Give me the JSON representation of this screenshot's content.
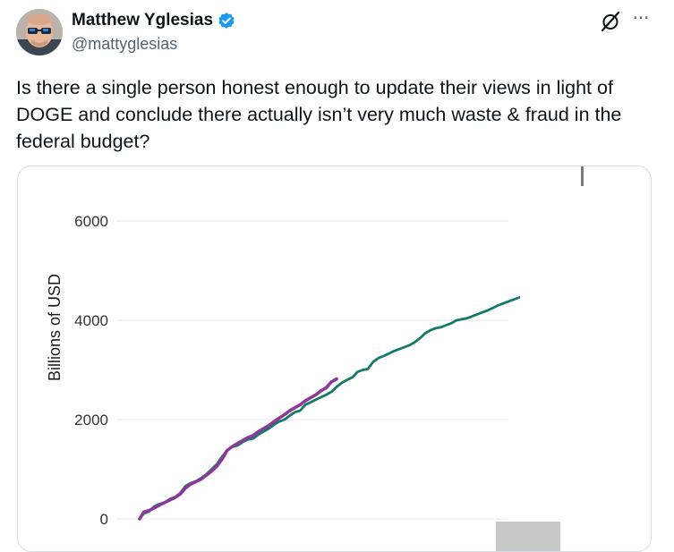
{
  "author": {
    "name": "Matthew Yglesias",
    "handle": "@mattyglesias",
    "verified": true,
    "verified_color": "#1d9bf0"
  },
  "icons": {
    "grok": "grok-slash-icon",
    "more": "more-horizontal-icon",
    "more_glyph": "···"
  },
  "tweet": {
    "text": "Is there a single person honest enough to update their views in light of DOGE and conclude there actually isn’t very much waste & fraud in the federal budget?"
  },
  "chart_data": {
    "type": "line",
    "title": "",
    "xlabel": "",
    "ylabel": "Billions of USD",
    "ylim": [
      0,
      6000
    ],
    "yticks": [
      "6000",
      "4000",
      "2000",
      "0"
    ],
    "grid": true,
    "colors": {
      "series_a": "#137a6a",
      "series_b": "#8b3a97",
      "bar": "#c8c8c8"
    },
    "series": [
      {
        "x": [
          1,
          5,
          10,
          15,
          20,
          25,
          30,
          35,
          40,
          45,
          50,
          55,
          60,
          65,
          70,
          75,
          80,
          85,
          90,
          95,
          100,
          105,
          110,
          115,
          120,
          125,
          130,
          135,
          140,
          145,
          150,
          155,
          160,
          165,
          170,
          175,
          180,
          185,
          190,
          195,
          200,
          205,
          210,
          215,
          220,
          225,
          230,
          235,
          240,
          245,
          250,
          255,
          260,
          265,
          270,
          275,
          280,
          285,
          290,
          295,
          300,
          305,
          310,
          315,
          320,
          325,
          330,
          335,
          340,
          345,
          350,
          355,
          360,
          365
        ],
        "values": [
          0,
          110,
          150,
          250,
          300,
          330,
          400,
          440,
          520,
          660,
          720,
          760,
          820,
          900,
          1000,
          1100,
          1250,
          1380,
          1450,
          1480,
          1550,
          1600,
          1620,
          1700,
          1760,
          1820,
          1900,
          1960,
          2000,
          2080,
          2150,
          2180,
          2300,
          2350,
          2400,
          2450,
          2500,
          2560,
          2660,
          2740,
          2800,
          2850,
          2960,
          3000,
          3020,
          3160,
          3240,
          3280,
          3330,
          3380,
          3420,
          3460,
          3500,
          3560,
          3640,
          3740,
          3800,
          3840,
          3860,
          3900,
          3940,
          4000,
          4020,
          4040,
          4080,
          4120,
          4160,
          4200,
          4250,
          4300,
          4340,
          4380,
          4420,
          4460
        ]
      },
      {
        "x": [
          1,
          5,
          10,
          15,
          20,
          25,
          30,
          35,
          40,
          45,
          50,
          55,
          60,
          65,
          70,
          75,
          80,
          85,
          90,
          95,
          100,
          105,
          110,
          115,
          120,
          125,
          130,
          135,
          140,
          145,
          150,
          155,
          160,
          165,
          170,
          175,
          180,
          185,
          190
        ],
        "values": [
          0,
          140,
          170,
          220,
          280,
          330,
          380,
          430,
          500,
          620,
          700,
          750,
          800,
          880,
          960,
          1060,
          1200,
          1380,
          1460,
          1520,
          1580,
          1640,
          1680,
          1760,
          1820,
          1880,
          1960,
          2030,
          2100,
          2180,
          2240,
          2300,
          2380,
          2440,
          2500,
          2580,
          2640,
          2760,
          2820
        ]
      }
    ],
    "xrange": [
      1,
      560
    ]
  }
}
